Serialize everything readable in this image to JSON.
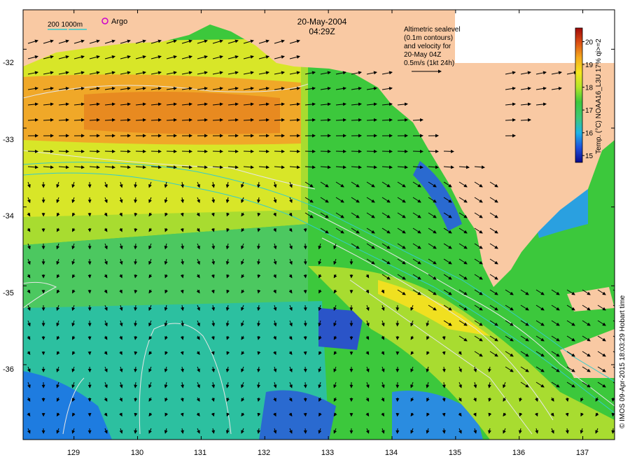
{
  "header": {
    "date": "20-May-2004",
    "time": "04:29Z"
  },
  "legend": {
    "isobath_label": "200 1000m",
    "argo_label": "Argo",
    "isobath_color": "#33cccc",
    "argo_color": "#cc00cc"
  },
  "note": {
    "lines": [
      "Altimetric sealevel",
      "(0.1m contours)",
      "and velocity for",
      "20-May 04Z",
      "0.5m/s (1kt 24h)"
    ]
  },
  "colorbar": {
    "title": "Temp. (°C) NOAA16_L3U 17% qi>=2",
    "ticks": [
      "15",
      "16",
      "17",
      "18",
      "19",
      "20"
    ],
    "range": [
      14.7,
      20.6
    ],
    "stops": [
      "#0a0a8c",
      "#1e50dc",
      "#1eb4e6",
      "#3cc878",
      "#3cc83c",
      "#b4e628",
      "#f5e61e",
      "#f5aa1e",
      "#dc5014",
      "#a00a0a"
    ]
  },
  "axes": {
    "x_ticks": [
      "129",
      "130",
      "131",
      "132",
      "133",
      "134",
      "135",
      "136",
      "137"
    ],
    "y_ticks": [
      "-32",
      "-33",
      "-34",
      "-35",
      "-36"
    ],
    "lon_range": [
      128.2,
      137.5
    ],
    "lat_range": [
      -36.95,
      -31.5
    ]
  },
  "credit": "© IMOS 09-Apr-2015 18:03:29 Hobart time",
  "colors": {
    "land": "#f9c9a3",
    "ocean_deep": "#3cc83c",
    "warm_band": "#f0a828",
    "cool_water": "#1e7ce0",
    "contour": "#e6e6e6"
  }
}
